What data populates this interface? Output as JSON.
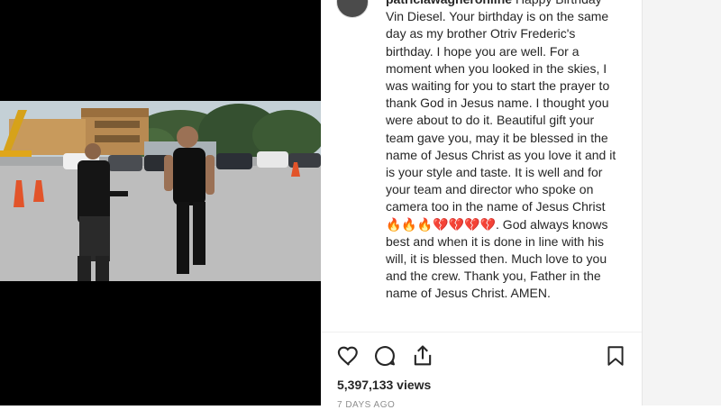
{
  "post": {
    "username": "patriciawagnerohline",
    "caption": "Happy Birthday Vin Diesel. Your birthday is on the same day as my brother Otriv Frederic's birthday. I hope you are well. For a moment when you looked in the skies, I was waiting for you to start the prayer to thank God in Jesus name. I thought you were about to do it. Beautiful gift your team gave you, may it be blessed in the name of Jesus Christ as you love it and it is your style and taste. It is well and for your team and director who spoke on camera too in the name of Jesus Christ 🔥🔥🔥💔💔💔💔. God always knows best and when it is done in line with his will, it is blessed then. Much love to you and the crew. Thank you, Father in the name of Jesus Christ. AMEN.",
    "views": "5,397,133 views",
    "timestamp": "7 DAYS AGO"
  },
  "icons": {
    "like": "heart-icon",
    "comment": "comment-bubble-icon",
    "share": "share-icon",
    "save": "bookmark-icon"
  },
  "colors": {
    "text": "#262626",
    "muted": "#8e8e8e",
    "media_bg": "#000000",
    "gutter": "#f4f4f4"
  }
}
